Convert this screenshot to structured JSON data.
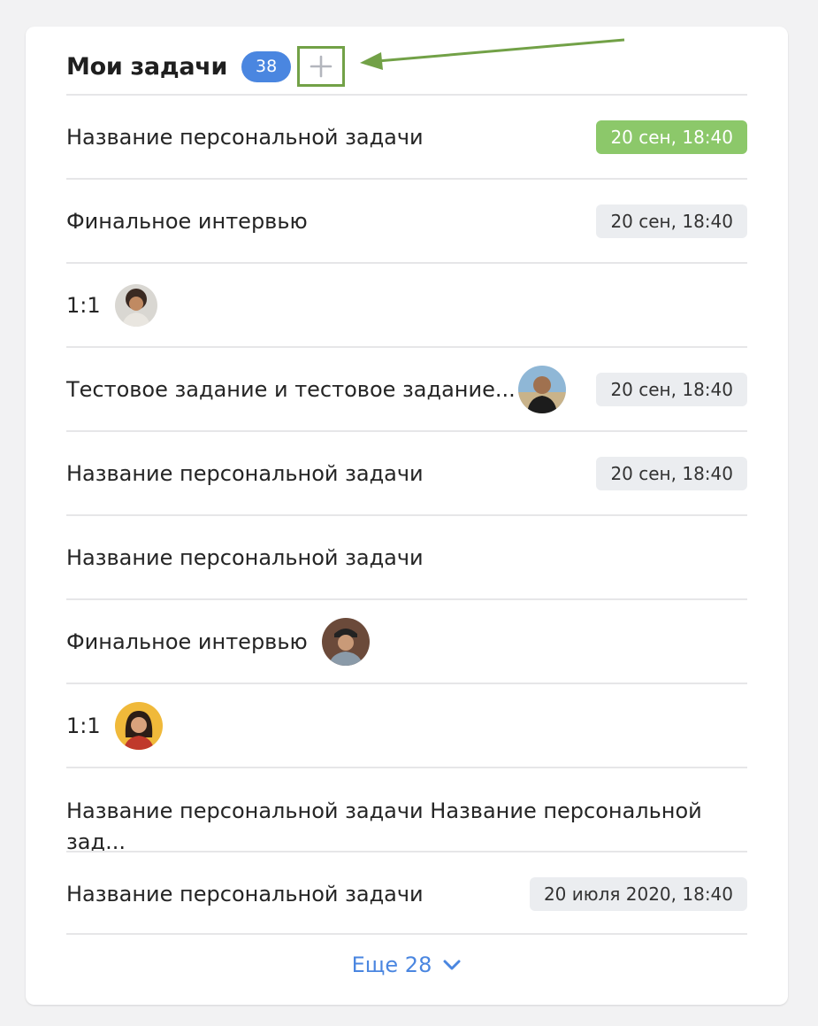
{
  "header": {
    "title": "Мои задачи",
    "count": "38",
    "add_icon": "plus-icon"
  },
  "colors": {
    "accent": "#4a86e0",
    "green_badge": "#8cc86a",
    "annotation_arrow": "#72a147",
    "badge_bg": "#ebedf0"
  },
  "tasks": [
    {
      "title": "Название персональной задачи",
      "date": "20 сен, 18:40",
      "date_style": "green"
    },
    {
      "title": "Финальное интервью",
      "date": "20 сен, 18:40"
    },
    {
      "title": "1:1",
      "avatar": "avatar-curly-hair"
    },
    {
      "title": "Тестовое задание и тестовое задание...",
      "avatar": "avatar-bald-man",
      "date": "20 сен, 18:40"
    },
    {
      "title": "Название персональной задачи",
      "date": "20 сен, 18:40"
    },
    {
      "title": "Название персональной задачи"
    },
    {
      "title": "Финальное интервью",
      "avatar": "avatar-cap-man"
    },
    {
      "title": "1:1",
      "avatar": "avatar-woman"
    },
    {
      "title": "Название персональной задачи Название персональной зад..."
    },
    {
      "title": "Название персональной задачи",
      "date": "20 июля 2020, 18:40"
    }
  ],
  "more": {
    "label": "Еще 28",
    "icon": "chevron-down-icon"
  }
}
